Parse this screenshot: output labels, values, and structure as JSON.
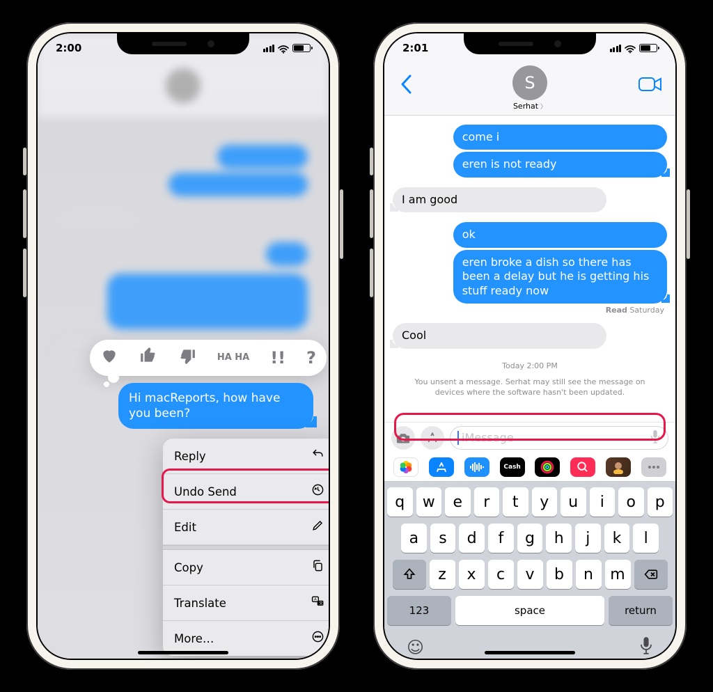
{
  "phone1": {
    "time": "2:00",
    "tapbacks": [
      "heart",
      "thumbs-up",
      "thumbs-down",
      "haha",
      "exclaim",
      "question"
    ],
    "tapback_labels": {
      "haha": "HA HA",
      "exclaim": "!!",
      "question": "?"
    },
    "focused_message": "Hi macReports, how have you been?",
    "menu": {
      "reply": "Reply",
      "undo_send": "Undo Send",
      "edit": "Edit",
      "copy": "Copy",
      "translate": "Translate",
      "more": "More…"
    }
  },
  "phone2": {
    "time": "2:01",
    "contact_name": "Serhat",
    "contact_initial": "S",
    "messages": [
      {
        "dir": "out",
        "text": "come i"
      },
      {
        "dir": "out",
        "text": "eren is not ready",
        "tail": true
      },
      {
        "dir": "in",
        "text": "I am good",
        "tail": true
      },
      {
        "dir": "out",
        "text": "ok"
      },
      {
        "dir": "out",
        "text": "eren broke a dish so there has been a delay but he is getting his stuff ready now",
        "tail": true
      },
      {
        "dir": "in",
        "text": "Cool",
        "tail": true
      }
    ],
    "read_receipt_label": "Read",
    "read_receipt_time": "Saturday",
    "timestamp": "Today 2:00 PM",
    "unsent_notice": "You unsent a message. Serhat may still see the message on devices where the software hasn't been updated.",
    "input_placeholder": "iMessage",
    "apps": [
      "photos",
      "store",
      "music",
      "cash",
      "fitness",
      "web",
      "memoji",
      "more"
    ],
    "cash_label": "Cash",
    "keyboard": {
      "row1": [
        "q",
        "w",
        "e",
        "r",
        "t",
        "y",
        "u",
        "i",
        "o",
        "p"
      ],
      "row2": [
        "a",
        "s",
        "d",
        "f",
        "g",
        "h",
        "j",
        "k",
        "l"
      ],
      "row3": [
        "z",
        "x",
        "c",
        "v",
        "b",
        "n",
        "m"
      ],
      "numbers": "123",
      "space": "space",
      "return": "return"
    }
  },
  "highlight_color": "#e6174a"
}
